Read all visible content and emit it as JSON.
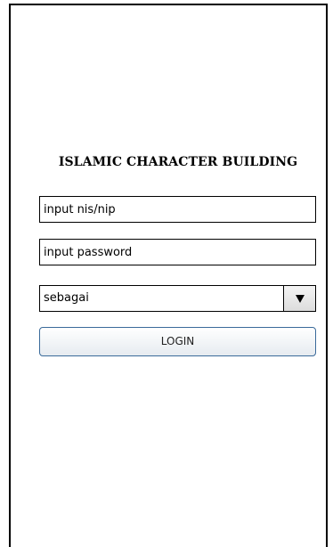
{
  "app": {
    "title": "ISLAMIC CHARACTER BUILDING"
  },
  "form": {
    "nis_field": {
      "value": "input nis/nip",
      "placeholder": ""
    },
    "password_field": {
      "value": "input password",
      "placeholder": ""
    },
    "role_select": {
      "selected": "sebagai",
      "icon": "dropdown-arrow-icon"
    },
    "login_label": "LOGIN"
  },
  "colors": {
    "login_border": "#3a6a9a",
    "frame": "#000000"
  }
}
